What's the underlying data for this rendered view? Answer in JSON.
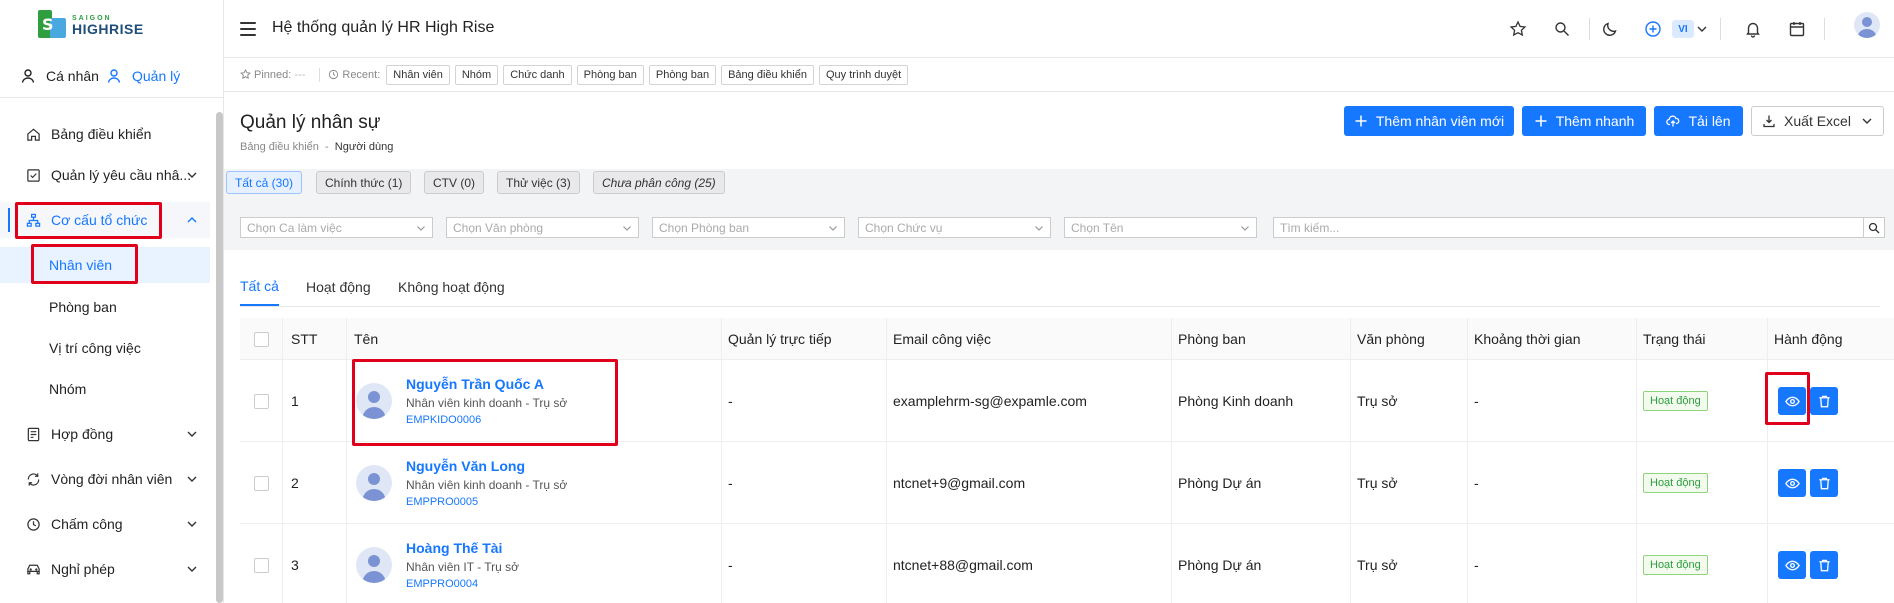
{
  "brand": {
    "line1": "SAIGON",
    "line2": "HIGHRISE",
    "green": "#2e9e3f",
    "blue": "#1f4e79"
  },
  "accent": "#1677ff",
  "roles": {
    "personal": "Cá nhân",
    "manage": "Quản lý"
  },
  "sidebar": {
    "items": [
      {
        "label": "Bảng điều khiển",
        "icon": "home-icon"
      },
      {
        "label": "Quản lý yêu cầu nhâ...",
        "icon": "checkbox-icon"
      },
      {
        "label": "Cơ cấu tổ chức",
        "icon": "org-structure-icon"
      },
      {
        "label": "Hợp đồng",
        "icon": "contract-icon"
      },
      {
        "label": "Vòng đời nhân viên",
        "icon": "cycle-icon"
      },
      {
        "label": "Chấm công",
        "icon": "clock-icon"
      },
      {
        "label": "Nghỉ phép",
        "icon": "car-icon"
      }
    ],
    "sub_items": [
      {
        "label": "Nhân viên"
      },
      {
        "label": "Phòng ban"
      },
      {
        "label": "Vị trí công việc"
      },
      {
        "label": "Nhóm"
      }
    ]
  },
  "header": {
    "title": "Hệ thống quản lý HR High Rise",
    "lang": "VI"
  },
  "pinned": {
    "pinned_label": "Pinned:",
    "pinned_value": "---",
    "recent_label": "Recent:",
    "recent": [
      "Nhân viên",
      "Nhóm",
      "Chức danh",
      "Phòng ban",
      "Phòng ban",
      "Bảng điều khiển",
      "Quy trình duyệt"
    ]
  },
  "page": {
    "title": "Quản lý nhân sự",
    "breadcrumb": [
      "Bảng điều khiển",
      "Người dùng"
    ],
    "buttons": {
      "add_employee": "Thêm nhân viên mới",
      "quick_add": "Thêm nhanh",
      "upload": "Tải lên",
      "export": "Xuất Excel"
    }
  },
  "status_chips": [
    "Tất cả (30)",
    "Chính thức (1)",
    "CTV (0)",
    "Thử việc (3)",
    "Chưa phân công (25)"
  ],
  "filters": {
    "shift": "Chọn Ca làm việc",
    "office": "Chọn Văn phòng",
    "department": "Chọn Phòng ban",
    "position": "Chọn Chức vụ",
    "name": "Chọn Tên",
    "search": "Tìm kiếm..."
  },
  "tabs": [
    "Tất cả",
    "Hoạt động",
    "Không hoạt động"
  ],
  "table": {
    "columns": [
      "STT",
      "Tên",
      "Quản lý trực tiếp",
      "Email công việc",
      "Phòng ban",
      "Văn phòng",
      "Khoảng thời gian",
      "Trạng thái",
      "Hành động"
    ],
    "rows": [
      {
        "stt": "1",
        "name": "Nguyễn Trần Quốc A",
        "role": "Nhân viên kinh doanh - Trụ sở",
        "code": "EMPKIDO0006",
        "manager": "-",
        "email": "examplehrm-sg@expamle.com",
        "department": "Phòng Kinh doanh",
        "office": "Trụ sở",
        "period": "-",
        "status": "Hoạt động"
      },
      {
        "stt": "2",
        "name": "Nguyễn Văn Long",
        "role": "Nhân viên kinh doanh - Trụ sở",
        "code": "EMPPRO0005",
        "manager": "-",
        "email": "ntcnet+9@gmail.com",
        "department": "Phòng Dự án",
        "office": "Trụ sở",
        "period": "-",
        "status": "Hoạt động"
      },
      {
        "stt": "3",
        "name": "Hoàng Thế Tài",
        "role": "Nhân viên IT - Trụ sở",
        "code": "EMPPRO0004",
        "manager": "-",
        "email": "ntcnet+88@gmail.com",
        "department": "Phòng Dự án",
        "office": "Trụ sở",
        "period": "-",
        "status": "Hoạt động"
      }
    ]
  }
}
